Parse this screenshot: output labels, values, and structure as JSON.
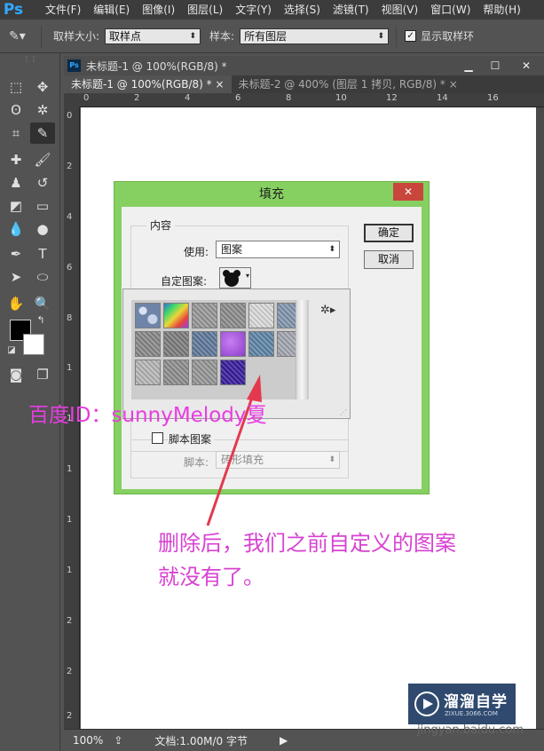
{
  "app": {
    "logo": "Ps",
    "menus": [
      "文件(F)",
      "编辑(E)",
      "图像(I)",
      "图层(L)",
      "文字(Y)",
      "选择(S)",
      "滤镜(T)",
      "视图(V)",
      "窗口(W)",
      "帮助(H)"
    ]
  },
  "options_bar": {
    "sample_size_label": "取样大小:",
    "sample_size_value": "取样点",
    "sample_label": "样本:",
    "sample_value": "所有图层",
    "show_ring_label": "显示取样环",
    "show_ring_checked": true
  },
  "document": {
    "window_title": "未标题-1 @ 100%(RGB/8) *",
    "tabs": [
      {
        "label": "未标题-1 @ 100%(RGB/8) *",
        "active": true
      },
      {
        "label": "未标题-2 @ 400% (图层 1 拷贝, RGB/8) *",
        "active": false
      }
    ],
    "ruler_h": [
      "0",
      "2",
      "4",
      "6",
      "8",
      "10",
      "12",
      "14",
      "16"
    ],
    "ruler_v": [
      "0",
      "2",
      "4",
      "6",
      "8",
      "1",
      "1",
      "1",
      "1",
      "1",
      "2",
      "2",
      "2",
      "2",
      "2",
      "3"
    ],
    "status_zoom": "100%",
    "status_doc": "文档:1.00M/0 字节"
  },
  "dialog": {
    "title": "填充",
    "content_group": "内容",
    "use_label": "使用:",
    "use_value": "图案",
    "custom_pattern_label": "自定图案:",
    "ok_label": "确定",
    "cancel_label": "取消",
    "script_label": "脚本图案",
    "script_checked": false,
    "script_field_label": "脚本:",
    "script_value": "砖形填充"
  },
  "pattern_swatches": [
    {
      "color": "#6f84a8",
      "pattern": "bubbles"
    },
    {
      "color": "#c9a03a",
      "pattern": "rainbow"
    },
    {
      "color": "#9a9a9a",
      "pattern": "weave"
    },
    {
      "color": "#8e8e8e",
      "pattern": "gray"
    },
    {
      "color": "#dcdcdc",
      "pattern": "light"
    },
    {
      "color": "#8397b0",
      "pattern": "blue-gray"
    },
    {
      "color": "#8a8a8a",
      "pattern": "fabric"
    },
    {
      "color": "#7e7e7e",
      "pattern": "noise"
    },
    {
      "color": "#607a9e",
      "pattern": "blue"
    },
    {
      "color": "#8e3ec9",
      "pattern": "purple"
    },
    {
      "color": "#5f87a8",
      "pattern": "steel"
    },
    {
      "color": "#a5a8b3",
      "pattern": "silver"
    },
    {
      "color": "#b8b8b8",
      "pattern": "paper"
    },
    {
      "color": "#909090",
      "pattern": "stone"
    },
    {
      "color": "#989898",
      "pattern": "rough"
    },
    {
      "color": "#3a1e9e",
      "pattern": "indigo"
    }
  ],
  "annotations": {
    "baidu_id": "百度ID：sunnyMelody夏",
    "note_line1": "删除后，我们之前自定义的图案",
    "note_line2": "就没有了。"
  },
  "watermark": {
    "brand": "溜溜自学",
    "url": "ZIXUE.3066.COM",
    "site": "jingyan.baidu.com"
  }
}
